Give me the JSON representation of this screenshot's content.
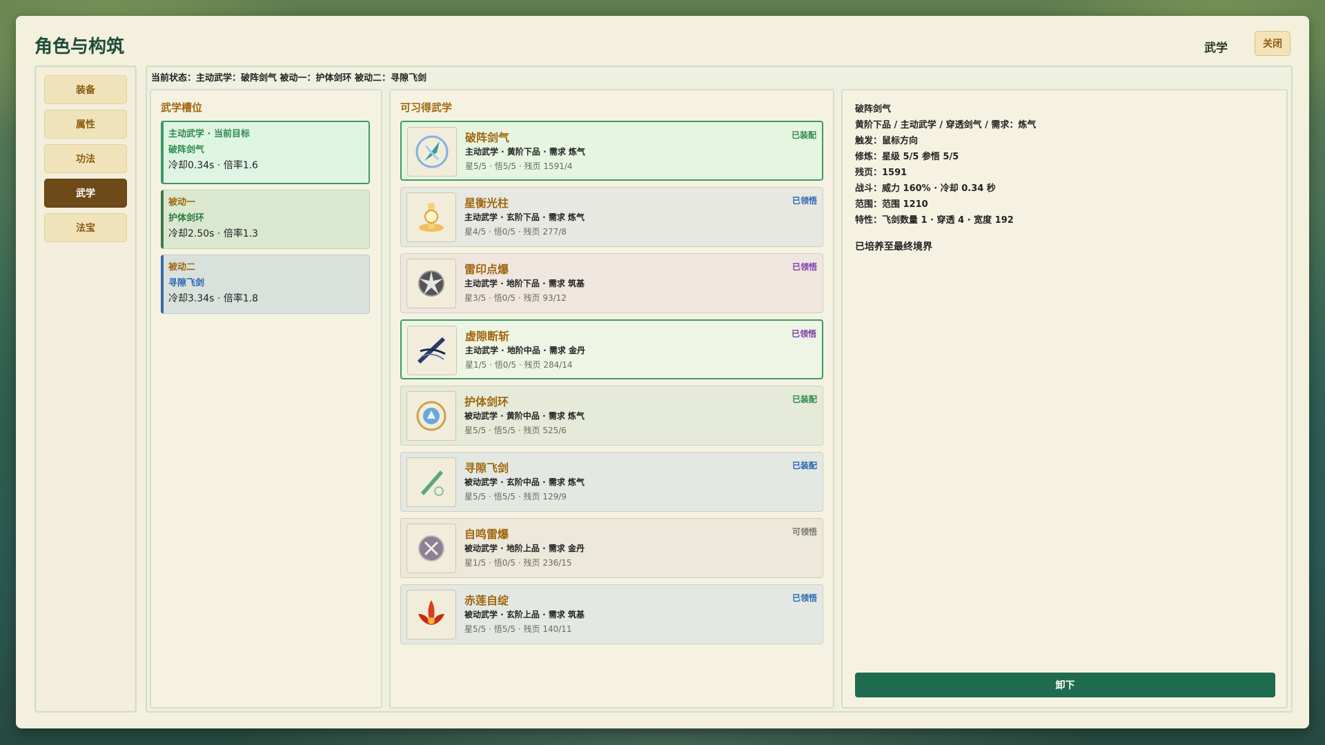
{
  "window": {
    "title": "角色与构筑",
    "breadcrumb": "武学",
    "close_label": "关闭"
  },
  "nav": {
    "items": [
      {
        "label": "装备",
        "active": false
      },
      {
        "label": "属性",
        "active": false
      },
      {
        "label": "功法",
        "active": false
      },
      {
        "label": "武学",
        "active": true
      },
      {
        "label": "法宝",
        "active": false
      }
    ]
  },
  "status_line": "当前状态：主动武学：破阵剑气  被动一：护体剑环  被动二：寻隙飞剑",
  "slots": {
    "title": "武学槽位",
    "items": [
      {
        "type": "主动武学 · 当前目标",
        "name": "破阵剑气",
        "stats": "冷却0.34s · 倍率1.6"
      },
      {
        "type": "被动一",
        "name": "护体剑环",
        "stats": "冷却2.50s · 倍率1.3"
      },
      {
        "type": "被动二",
        "name": "寻隙飞剑",
        "stats": "冷却3.34s · 倍率1.8"
      }
    ]
  },
  "skills": {
    "title": "可习得武学",
    "items": [
      {
        "name": "破阵剑气",
        "meta": "主动武学 · 黄阶下品 · 需求 炼气",
        "progress": "星5/5 · 悟5/5 · 残页 1591/4",
        "tag": "已装配",
        "tag_color": "#2e8a4e",
        "bg": "#e6f5e0",
        "icon": "sword-qi-icon"
      },
      {
        "name": "星衡光柱",
        "meta": "主动武学 · 玄阶下品 · 需求 炼气",
        "progress": "星4/5 · 悟0/5 · 残页 277/8",
        "tag": "已领悟",
        "tag_color": "#2a64b4",
        "bg": "#e6e8e1",
        "icon": "light-pillar-icon"
      },
      {
        "name": "雷印点爆",
        "meta": "主动武学 · 地阶下品 · 需求 筑基",
        "progress": "星3/5 · 悟0/5 · 残页 93/12",
        "tag": "已领悟",
        "tag_color": "#7a3aa8",
        "bg": "#f0e6e0",
        "icon": "thunder-seal-icon"
      },
      {
        "name": "虚隙断斩",
        "meta": "主动武学 · 地阶中品 · 需求 金丹",
        "progress": "星1/5 · 悟0/5 · 残页 284/14",
        "tag": "已领悟",
        "tag_color": "#7a3aa8",
        "bg": "#eef5e4",
        "icon": "void-slash-icon"
      },
      {
        "name": "护体剑环",
        "meta": "被动武学 · 黄阶中品 · 需求 炼气",
        "progress": "星5/5 · 悟5/5 · 残页 525/6",
        "tag": "已装配",
        "tag_color": "#2e8a4e",
        "bg": "#e6ead9",
        "icon": "sword-ring-icon"
      },
      {
        "name": "寻隙飞剑",
        "meta": "被动武学 · 玄阶中品 · 需求 炼气",
        "progress": "星5/5 · 悟5/5 · 残页 129/9",
        "tag": "已装配",
        "tag_color": "#2a64b4",
        "bg": "#e4e8e2",
        "icon": "flying-sword-icon"
      },
      {
        "name": "自鸣雷爆",
        "meta": "被动武学 · 地阶上品 · 需求 金丹",
        "progress": "星1/5 · 悟0/5 · 残页 236/15",
        "tag": "可领悟",
        "tag_color": "#7a7a6a",
        "bg": "#ece8da",
        "icon": "thunder-burst-icon"
      },
      {
        "name": "赤莲自绽",
        "meta": "被动武学 · 玄阶上品 · 需求 筑基",
        "progress": "星5/5 · 悟5/5 · 残页 140/11",
        "tag": "已领悟",
        "tag_color": "#2a64b4",
        "bg": "#e4e8e2",
        "icon": "red-lotus-icon"
      }
    ]
  },
  "detail": {
    "lines": [
      "破阵剑气",
      "黄阶下品 / 主动武学 / 穿透剑气 / 需求：炼气",
      "触发：鼠标方向",
      "修炼：星级 5/5  参悟 5/5",
      "残页：1591",
      "战斗：威力 160% · 冷却 0.34 秒",
      "范围：范围 1210",
      "特性：飞剑数量 1 · 穿透 4 · 宽度 192"
    ],
    "cultivate_note": "已培养至最终境界",
    "unequip_label": "卸下"
  },
  "colors": {
    "accent_green": "#1f6b4f",
    "title_green": "#1d4d3a",
    "gold_text": "#a0660e",
    "nav_active": "#6d4a17"
  }
}
